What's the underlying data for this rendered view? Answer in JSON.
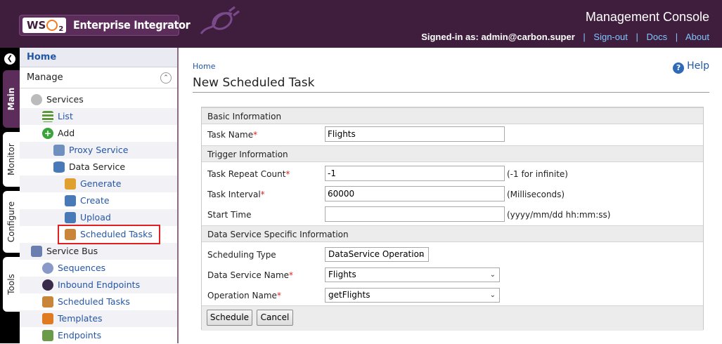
{
  "header": {
    "brand": "WSO2",
    "product": "Enterprise Integrator",
    "console_title": "Management Console",
    "signed_in_label": "Signed-in as:",
    "user": "admin@carbon.super",
    "links": [
      "Sign-out",
      "Docs",
      "About"
    ]
  },
  "vtabs": [
    "Main",
    "Monitor",
    "Configure",
    "Tools"
  ],
  "sidebar": {
    "home": "Home",
    "section": "Manage",
    "items": [
      {
        "label": "Services",
        "icon": "gear-icon"
      },
      {
        "label": "List",
        "icon": "list-icon"
      },
      {
        "label": "Add",
        "icon": "add-icon"
      },
      {
        "label": "Proxy Service",
        "icon": "proxy-service-icon"
      },
      {
        "label": "Data Service",
        "icon": "database-icon"
      },
      {
        "label": "Generate",
        "icon": "generate-icon"
      },
      {
        "label": "Create",
        "icon": "create-icon"
      },
      {
        "label": "Upload",
        "icon": "upload-icon"
      },
      {
        "label": "Scheduled Tasks",
        "icon": "scheduled-task-icon"
      },
      {
        "label": "Service Bus",
        "icon": "service-bus-icon"
      },
      {
        "label": "Sequences",
        "icon": "sequences-icon"
      },
      {
        "label": "Inbound Endpoints",
        "icon": "inbound-endpoint-icon"
      },
      {
        "label": "Scheduled Tasks",
        "icon": "scheduled-task-icon"
      },
      {
        "label": "Templates",
        "icon": "templates-icon"
      },
      {
        "label": "Endpoints",
        "icon": "endpoints-icon"
      }
    ]
  },
  "main": {
    "breadcrumb": "Home",
    "help": "Help",
    "title": "New Scheduled Task",
    "sections": {
      "basic": "Basic Information",
      "trigger": "Trigger Information",
      "ds": "Data Service Specific Information"
    },
    "fields": {
      "task_name": {
        "label": "Task Name",
        "value": "Flights"
      },
      "repeat_count": {
        "label": "Task Repeat Count",
        "value": "-1",
        "hint": "(-1 for infinite)"
      },
      "interval": {
        "label": "Task Interval",
        "value": "60000",
        "hint": "(Milliseconds)"
      },
      "start_time": {
        "label": "Start Time",
        "value": "",
        "hint": "(yyyy/mm/dd hh:mm:ss)"
      },
      "scheduling_type": {
        "label": "Scheduling Type",
        "value": "DataService Operation"
      },
      "ds_name": {
        "label": "Data Service Name",
        "value": "Flights"
      },
      "op_name": {
        "label": "Operation Name",
        "value": "getFlights"
      }
    },
    "required_mark": "*",
    "buttons": {
      "schedule": "Schedule",
      "cancel": "Cancel"
    }
  },
  "colors": {
    "header_bg": "#3f1e3d",
    "link": "#2456a6",
    "highlight": "#e02020"
  }
}
